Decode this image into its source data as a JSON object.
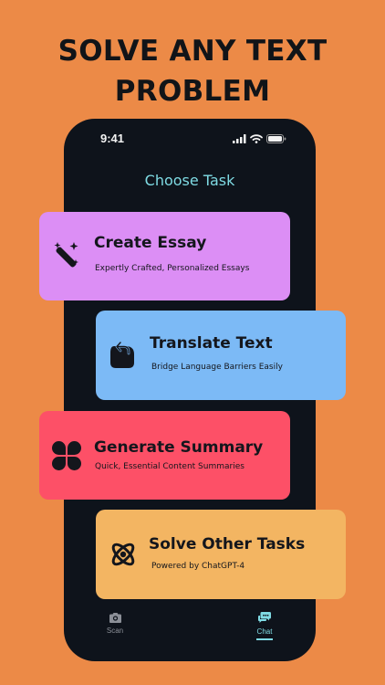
{
  "headline": {
    "line1": "SOLVE ANY TEXT",
    "line2": "PROBLEM"
  },
  "status_bar": {
    "time": "9:41"
  },
  "screen": {
    "title": "Choose Task"
  },
  "tasks": [
    {
      "title": "Create Essay",
      "subtitle": "Expertly Crafted, Personalized Essays",
      "color": "#dc8ef5",
      "icon": "magic-wand-icon"
    },
    {
      "title": "Translate Text",
      "subtitle": "Bridge Language Barriers Easily",
      "color": "#7cbaf6",
      "icon": "translate-bubble-icon"
    },
    {
      "title": "Generate Summary",
      "subtitle": "Quick, Essential Content Summaries",
      "color": "#fd5067",
      "icon": "four-leaf-grid-icon"
    },
    {
      "title": "Solve Other Tasks",
      "subtitle": "Powered by ChatGPT-4",
      "color": "#f3b562",
      "icon": "atom-icon"
    }
  ],
  "tab_bar": {
    "scan_label": "Scan",
    "chat_label": "Chat",
    "active": "chat",
    "active_color": "#7fdbe4"
  }
}
